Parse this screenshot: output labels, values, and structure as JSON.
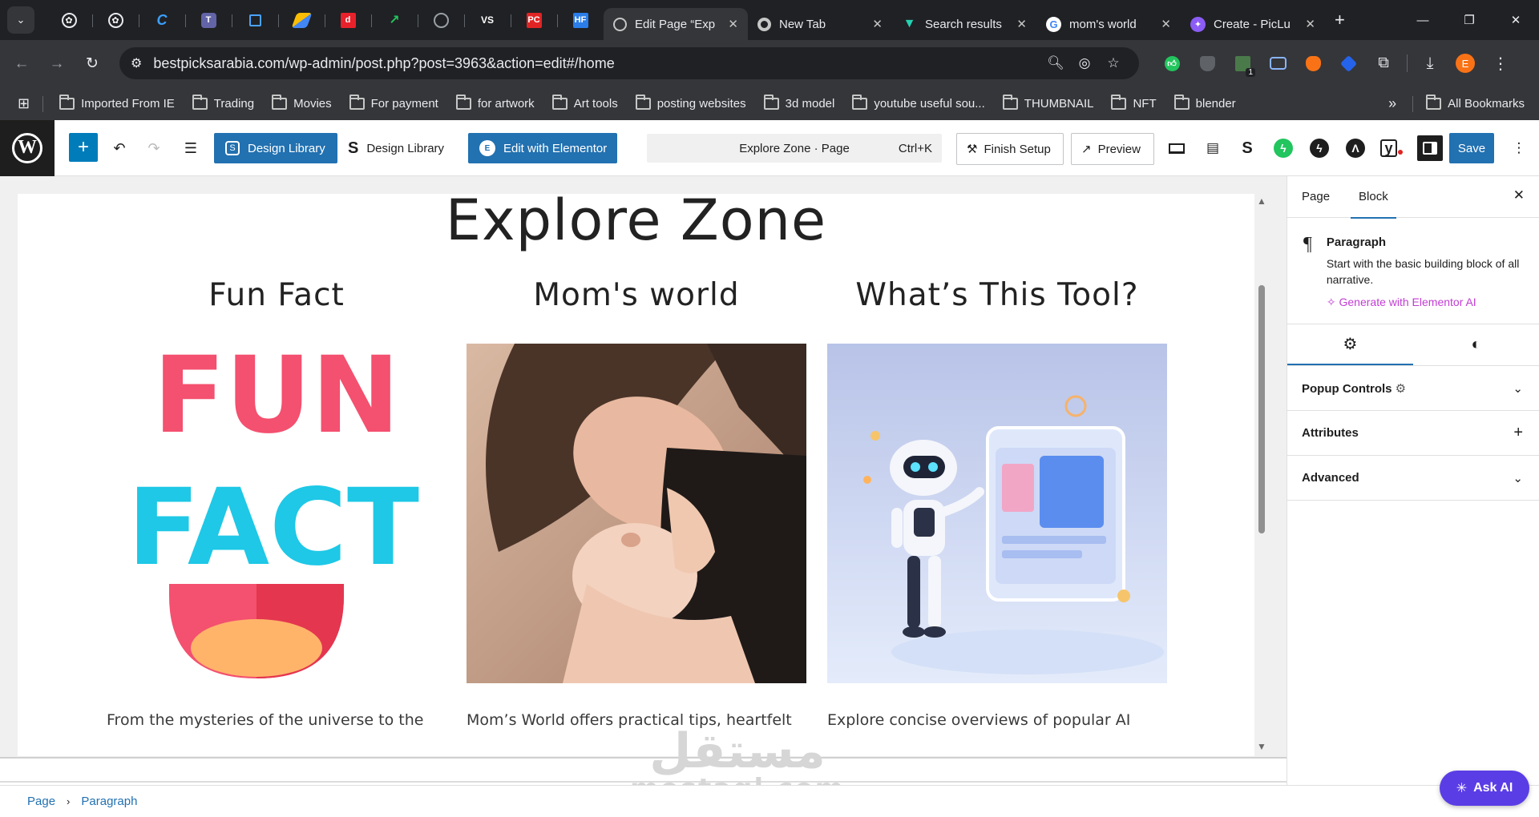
{
  "browser": {
    "pinned_tabs": [
      {
        "icon": "openai-icon",
        "color": "#ffffff"
      },
      {
        "icon": "openai-icon",
        "color": "#ffffff"
      },
      {
        "icon": "tools-c-icon",
        "color": "#3aa0ff"
      },
      {
        "icon": "teams-icon",
        "color": "#6264a7"
      },
      {
        "icon": "crop-icon",
        "color": "#4aa3ff"
      },
      {
        "icon": "google-ads-icon",
        "color": "#fbbc04"
      },
      {
        "icon": "d-app-icon",
        "color": "#e8212b"
      },
      {
        "icon": "trend-icon",
        "color": "#22c55e"
      },
      {
        "icon": "globe-icon",
        "color": "#9aa0a6"
      },
      {
        "icon": "vs-icon",
        "color": "#ffffff"
      },
      {
        "icon": "pc-icon",
        "color": "#e02424"
      },
      {
        "icon": "hf-icon",
        "color": "#2b7de9"
      }
    ],
    "tabs": [
      {
        "title": "Edit Page “Exp",
        "active": true,
        "icon": "globe-icon"
      },
      {
        "title": "New Tab",
        "active": false,
        "icon": "chrome-icon"
      },
      {
        "title": "Search results",
        "active": false,
        "icon": "v-icon"
      },
      {
        "title": "mom's world",
        "active": false,
        "icon": "google-icon"
      },
      {
        "title": "Create - PicLu",
        "active": false,
        "icon": "piclumen-icon"
      }
    ],
    "url": "bestpicksarabia.com/wp-admin/post.php?post=3963&action=edit#/home",
    "profile_initial": "E",
    "extension_badge": "1",
    "bookmarks": [
      "Imported From IE",
      "Trading",
      "Movies",
      "For payment",
      "for artwork",
      "Art tools",
      "posting websites",
      "3d model",
      "youtube useful sou...",
      "THUMBNAIL",
      "NFT",
      "blender"
    ],
    "all_bookmarks": "All Bookmarks"
  },
  "wp_toolbar": {
    "design_library_1": "Design Library",
    "design_library_2": "Design Library",
    "edit_elementor": "Edit with Elementor",
    "command_title": "Explore Zone · Page",
    "command_shortcut": "Ctrl+K",
    "finish_setup": "Finish Setup",
    "preview": "Preview",
    "save": "Save"
  },
  "canvas": {
    "title": "Explore Zone",
    "columns": [
      {
        "heading": "Fun Fact",
        "excerpt": "From the mysteries of the universe to the",
        "image_text": [
          "FUN",
          "FACT"
        ]
      },
      {
        "heading": "Mom's world",
        "excerpt": "Mom’s World offers practical tips, heartfelt"
      },
      {
        "heading": "What’s This Tool?",
        "excerpt": "Explore concise overviews of popular AI"
      }
    ]
  },
  "sidebar": {
    "tabs": [
      "Page",
      "Block"
    ],
    "block_name": "Paragraph",
    "block_desc": "Start with the basic building block of all narrative.",
    "ai_link": "Generate with Elementor AI",
    "panels": [
      "Popup Controls",
      "Attributes",
      "Advanced"
    ]
  },
  "breadcrumbs": [
    "Page",
    "Paragraph"
  ],
  "ask_ai": "Ask AI",
  "watermark": {
    "arabic": "مستقل",
    "latin": "mostaql.com"
  },
  "colors": {
    "wp_blue": "#2271b1",
    "ai_purple": "#c13dd3",
    "ask_ai_bg": "#5b3de6"
  }
}
